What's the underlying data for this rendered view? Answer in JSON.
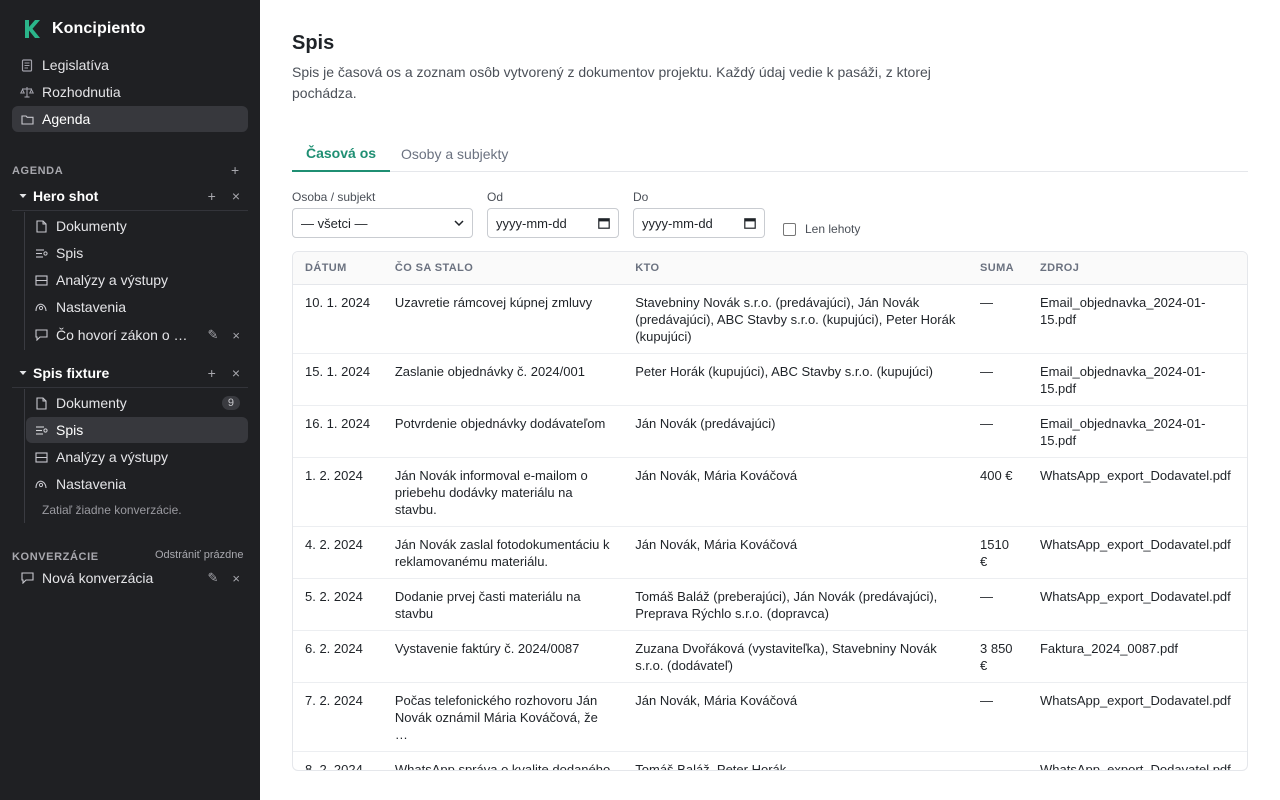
{
  "app": {
    "name": "Koncipiento"
  },
  "nav": {
    "items": [
      {
        "label": "Legislatíva",
        "icon": "document-list-icon"
      },
      {
        "label": "Rozhodnutia",
        "icon": "scales-icon"
      },
      {
        "label": "Agenda",
        "icon": "folder-icon"
      }
    ]
  },
  "agenda": {
    "section_label": "AGENDA",
    "add_label": "+",
    "projects": [
      {
        "title": "Hero shot",
        "items": [
          {
            "label": "Dokumenty",
            "icon": "file-icon"
          },
          {
            "label": "Spis",
            "icon": "timeline-icon"
          },
          {
            "label": "Analýzy a výstupy",
            "icon": "table-icon"
          },
          {
            "label": "Nastavenia",
            "icon": "settings-icon"
          },
          {
            "label": "Čo hovorí zákon o …",
            "icon": "chat-icon"
          }
        ]
      },
      {
        "title": "Spis fixture",
        "items": [
          {
            "label": "Dokumenty",
            "icon": "file-icon",
            "badge": "9"
          },
          {
            "label": "Spis",
            "icon": "timeline-icon"
          },
          {
            "label": "Analýzy a výstupy",
            "icon": "table-icon"
          },
          {
            "label": "Nastavenia",
            "icon": "settings-icon"
          }
        ],
        "empty_note": "Zatiaľ žiadne konverzácie."
      }
    ]
  },
  "conversations": {
    "section_label": "KONVERZÁCIE",
    "clear_label": "Odstrániť prázdne",
    "items": [
      {
        "label": "Nová konverzácia"
      }
    ]
  },
  "page": {
    "title": "Spis",
    "description": "Spis je časová os a zoznam osôb vytvorený z dokumentov projektu. Každý údaj vedie k pasáži, z ktorej pochádza.",
    "tabs": [
      {
        "label": "Časová os",
        "active": true
      },
      {
        "label": "Osoby a subjekty",
        "active": false
      }
    ]
  },
  "filters": {
    "person": {
      "label": "Osoba / subjekt",
      "value": "— všetci —"
    },
    "from": {
      "label": "Od",
      "placeholder": "yyyy-mm-dd"
    },
    "to": {
      "label": "Do",
      "placeholder": "yyyy-mm-dd"
    },
    "deadlines_only": {
      "label": "Len lehoty",
      "checked": false
    }
  },
  "table": {
    "headers": {
      "date": "DÁTUM",
      "what": "ČO SA STALO",
      "who": "KTO",
      "sum": "SUMA",
      "source": "ZDROJ"
    },
    "rows": [
      {
        "date": "10. 1. 2024",
        "what": "Uzavretie rámcovej kúpnej zmluvy",
        "who": "Stavebniny Novák s.r.o. (predávajúci), Ján Novák (predávajúci), ABC Stavby s.r.o. (kupujúci), Peter Horák (kupujúci)",
        "sum": "—",
        "source": "Email_objednavka_2024-01-15.pdf"
      },
      {
        "date": "15. 1. 2024",
        "what": "Zaslanie objednávky č. 2024/001",
        "who": "Peter Horák (kupujúci), ABC Stavby s.r.o. (kupujúci)",
        "sum": "—",
        "source": "Email_objednavka_2024-01-15.pdf"
      },
      {
        "date": "16. 1. 2024",
        "what": "Potvrdenie objednávky dodávateľom",
        "who": "Ján Novák (predávajúci)",
        "sum": "—",
        "source": "Email_objednavka_2024-01-15.pdf"
      },
      {
        "date": "1. 2. 2024",
        "what": "Ján Novák informoval e-mailom o priebehu dodávky materiálu na stavbu.",
        "who": "Ján Novák, Mária Kováčová",
        "sum": "400 €",
        "source": "WhatsApp_export_Dodavatel.pdf"
      },
      {
        "date": "4. 2. 2024",
        "what": "Ján Novák zaslal fotodokumentáciu k reklamovanému materiálu.",
        "who": "Ján Novák, Mária Kováčová",
        "sum": "1510 €",
        "source": "WhatsApp_export_Dodavatel.pdf"
      },
      {
        "date": "5. 2. 2024",
        "what": "Dodanie prvej časti materiálu na stavbu",
        "who": "Tomáš Baláž (preberajúci), Ján Novák (predávajúci), Preprava Rýchlo s.r.o. (dopravca)",
        "sum": "—",
        "source": "WhatsApp_export_Dodavatel.pdf"
      },
      {
        "date": "6. 2. 2024",
        "what": "Vystavenie faktúry č. 2024/0087",
        "who": "Zuzana Dvořáková (vystaviteľka), Stavebniny Novák s.r.o. (dodávateľ)",
        "sum": "3 850 €",
        "source": "Faktura_2024_0087.pdf"
      },
      {
        "date": "7. 2. 2024",
        "what": "Počas telefonického rozhovoru Ján Novák oznámil Mária Kováčová, že …",
        "who": "Ján Novák, Mária Kováčová",
        "sum": "—",
        "source": "WhatsApp_export_Dodavatel.pdf"
      },
      {
        "date": "8. 2. 2024",
        "what": "WhatsApp správa o kvalite dodaného materiálu",
        "who": "Tomáš Baláž, Peter Horák",
        "sum": "—",
        "source": "WhatsApp_export_Dodavatel.pdf"
      }
    ]
  },
  "colors": {
    "sidebar_bg": "#1f2023",
    "accent": "#1f8f73",
    "logo": "#2bb58a"
  }
}
